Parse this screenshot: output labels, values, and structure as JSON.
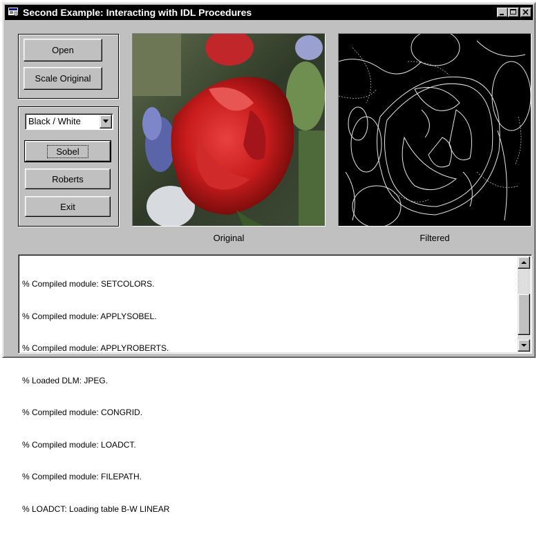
{
  "window": {
    "title": "Second Example: Interacting with IDL Procedures",
    "titlebar_color": "#000000",
    "icon": "app-window-icon",
    "controls": [
      "minimize-icon",
      "maximize-icon",
      "close-icon"
    ]
  },
  "file_group": {
    "open_label": "Open",
    "scale_label": "Scale Original"
  },
  "filter_group": {
    "colormap_selected": "Black / White",
    "sobel_label": "Sobel",
    "roberts_label": "Roberts",
    "exit_label": "Exit"
  },
  "images": {
    "original_caption": "Original",
    "filtered_caption": "Filtered"
  },
  "console": {
    "lines": [
      "% Compiled module: SETCOLORS.",
      "% Compiled module: APPLYSOBEL.",
      "% Compiled module: APPLYROBERTS.",
      "% Loaded DLM: JPEG.",
      "% Compiled module: CONGRID.",
      "% Compiled module: LOADCT.",
      "% Compiled module: FILEPATH.",
      "% LOADCT: Loading table B-W LINEAR"
    ]
  }
}
